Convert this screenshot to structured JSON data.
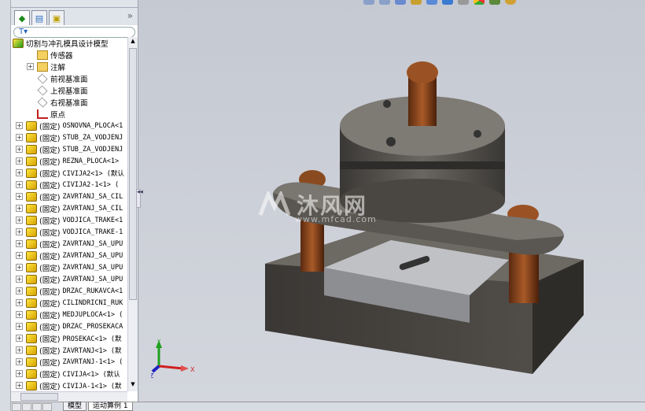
{
  "panel": {
    "tabs": [
      "feature-manager",
      "property-manager",
      "configuration-manager"
    ],
    "expand_glyph": "»",
    "filter_glyph": "T▾",
    "root": "切割与冲孔模具设计模型",
    "items": [
      {
        "label": "传感器",
        "icon": "sensor-folder",
        "expandable": false
      },
      {
        "label": "注解",
        "icon": "annotation-folder",
        "expandable": true
      },
      {
        "label": "前视基准面",
        "icon": "plane",
        "expandable": false
      },
      {
        "label": "上视基准面",
        "icon": "plane",
        "expandable": false
      },
      {
        "label": "右视基准面",
        "icon": "plane",
        "expandable": false
      },
      {
        "label": "原点",
        "icon": "origin",
        "expandable": false
      }
    ],
    "fixed_prefix": "(固定)",
    "parts": [
      "OSNOVNA_PLOCA<1",
      "STUB_ZA_VODJENJ",
      "STUB_ZA_VODJENJ",
      "REZNA_PLOCA<1>",
      "CIVIJA2<1> (默认",
      "CIVIJA2-1<1> (",
      "ZAVRTANJ_SA_CIL",
      "ZAVRTANJ_SA_CIL",
      "VODJICA_TRAKE<1",
      "VODJICA_TRAKE-1",
      "ZAVRTANJ_SA_UPU",
      "ZAVRTANJ_SA_UPU",
      "ZAVRTANJ_SA_UPU",
      "ZAVRTANJ_SA_UPU",
      "DRZAC_RUKAVCA<1",
      "CILINDRICNI_RUK",
      "MEDJUPLOCA<1> (",
      "DRZAC_PROSEKACA",
      "PROSEKAC<1> (默",
      "ZAVRTANJ<1> (默",
      "ZAVRTANJ-1<1> (",
      "CIVIJA<1> (默认",
      "CIVIJA-1<1> (默"
    ]
  },
  "bottom_tabs": [
    "模型",
    "运动算例 1"
  ],
  "triad": {
    "x": "X",
    "y": "Y",
    "z": "Z"
  },
  "watermark": {
    "name": "沐风网",
    "url": "www.mfcad.com"
  },
  "colors": {
    "viewport": "#c9cdd5",
    "part_icon": "#f0c800",
    "axis_x": "#d02020",
    "axis_y": "#20a020",
    "axis_z": "#2020c0"
  }
}
